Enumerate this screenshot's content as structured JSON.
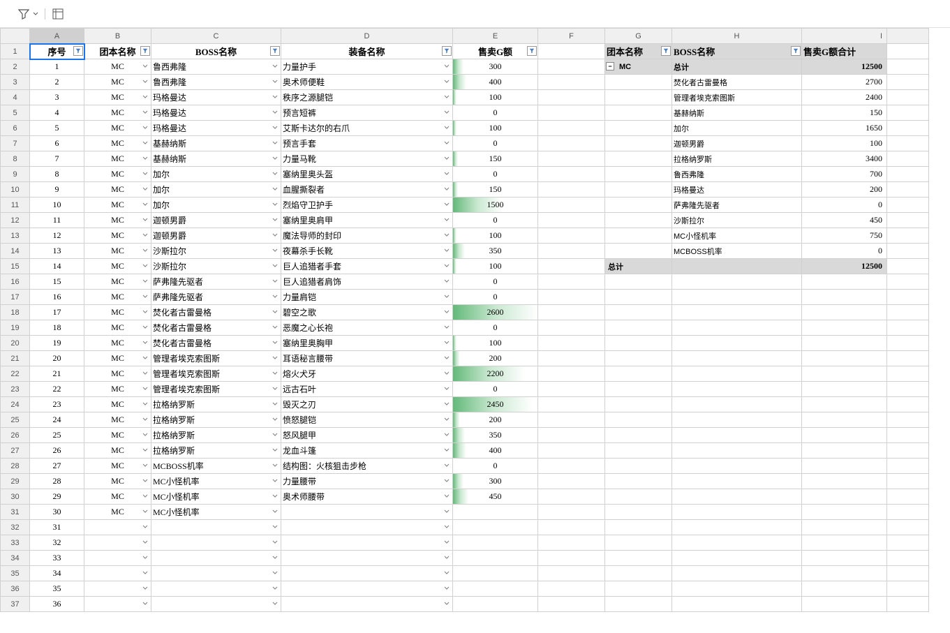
{
  "toolbar": {
    "filter_label": "筛选",
    "group_label": "分组"
  },
  "cols": [
    "A",
    "B",
    "C",
    "D",
    "E",
    "F",
    "G",
    "H",
    "I",
    ""
  ],
  "hdr": {
    "a": "序号",
    "b": "团本名称",
    "c": "BOSS名称",
    "d": "装备名称",
    "e": "售卖G额",
    "g": "团本名称",
    "h": "BOSS名称",
    "i": "售卖G额合计"
  },
  "rows": [
    {
      "n": "1",
      "a": "1",
      "b": "MC",
      "c": "鲁西弗隆",
      "d": "力量护手",
      "e": "300",
      "bar": 12
    },
    {
      "n": "2",
      "a": "2",
      "b": "MC",
      "c": "鲁西弗隆",
      "d": "奥术师便鞋",
      "e": "400",
      "bar": 16
    },
    {
      "n": "3",
      "a": "3",
      "b": "MC",
      "c": "玛格曼达",
      "d": "秩序之源腿铠",
      "e": "100",
      "bar": 4
    },
    {
      "n": "4",
      "a": "4",
      "b": "MC",
      "c": "玛格曼达",
      "d": "预言短裤",
      "e": "0",
      "bar": 0
    },
    {
      "n": "5",
      "a": "5",
      "b": "MC",
      "c": "玛格曼达",
      "d": "艾斯卡达尔的右爪",
      "e": "100",
      "bar": 4
    },
    {
      "n": "6",
      "a": "6",
      "b": "MC",
      "c": "基赫纳斯",
      "d": "预言手套",
      "e": "0",
      "bar": 0
    },
    {
      "n": "7",
      "a": "7",
      "b": "MC",
      "c": "基赫纳斯",
      "d": "力量马靴",
      "e": "150",
      "bar": 6
    },
    {
      "n": "8",
      "a": "8",
      "b": "MC",
      "c": "加尔",
      "d": "塞纳里奥头盔",
      "e": "0",
      "bar": 0
    },
    {
      "n": "9",
      "a": "9",
      "b": "MC",
      "c": "加尔",
      "d": "血腥撕裂者",
      "e": "150",
      "bar": 6
    },
    {
      "n": "10",
      "a": "10",
      "b": "MC",
      "c": "加尔",
      "d": "烈焰守卫护手",
      "e": "1500",
      "bar": 58
    },
    {
      "n": "11",
      "a": "11",
      "b": "MC",
      "c": "迦顿男爵",
      "d": "塞纳里奥肩甲",
      "e": "0",
      "bar": 0
    },
    {
      "n": "12",
      "a": "12",
      "b": "MC",
      "c": "迦顿男爵",
      "d": "魔法导师的封印",
      "e": "100",
      "bar": 4
    },
    {
      "n": "13",
      "a": "13",
      "b": "MC",
      "c": "沙斯拉尔",
      "d": "夜幕杀手长靴",
      "e": "350",
      "bar": 14
    },
    {
      "n": "14",
      "a": "14",
      "b": "MC",
      "c": "沙斯拉尔",
      "d": "巨人追猎者手套",
      "e": "100",
      "bar": 4
    },
    {
      "n": "15",
      "a": "15",
      "b": "MC",
      "c": "萨弗隆先驱者",
      "d": "巨人追猎者肩饰",
      "e": "0",
      "bar": 0
    },
    {
      "n": "16",
      "a": "16",
      "b": "MC",
      "c": "萨弗隆先驱者",
      "d": "力量肩铠",
      "e": "0",
      "bar": 0
    },
    {
      "n": "17",
      "a": "17",
      "b": "MC",
      "c": "焚化者古雷曼格",
      "d": "碧空之歌",
      "e": "2600",
      "bar": 100
    },
    {
      "n": "18",
      "a": "18",
      "b": "MC",
      "c": "焚化者古雷曼格",
      "d": "恶魔之心长袍",
      "e": "0",
      "bar": 0
    },
    {
      "n": "19",
      "a": "19",
      "b": "MC",
      "c": "焚化者古雷曼格",
      "d": "塞纳里奥胸甲",
      "e": "100",
      "bar": 4
    },
    {
      "n": "20",
      "a": "20",
      "b": "MC",
      "c": "管理者埃克索图斯",
      "d": "耳语秘言腰带",
      "e": "200",
      "bar": 8
    },
    {
      "n": "21",
      "a": "21",
      "b": "MC",
      "c": "管理者埃克索图斯",
      "d": "熔火犬牙",
      "e": "2200",
      "bar": 85
    },
    {
      "n": "22",
      "a": "22",
      "b": "MC",
      "c": "管理者埃克索图斯",
      "d": "远古石叶",
      "e": "0",
      "bar": 0
    },
    {
      "n": "23",
      "a": "23",
      "b": "MC",
      "c": "拉格纳罗斯",
      "d": "毁灭之刃",
      "e": "2450",
      "bar": 94
    },
    {
      "n": "24",
      "a": "24",
      "b": "MC",
      "c": "拉格纳罗斯",
      "d": "愤怒腿铠",
      "e": "200",
      "bar": 8
    },
    {
      "n": "25",
      "a": "25",
      "b": "MC",
      "c": "拉格纳罗斯",
      "d": "怒风腿甲",
      "e": "350",
      "bar": 14
    },
    {
      "n": "26",
      "a": "26",
      "b": "MC",
      "c": "拉格纳罗斯",
      "d": "龙血斗篷",
      "e": "400",
      "bar": 16
    },
    {
      "n": "27",
      "a": "27",
      "b": "MC",
      "c": "MCBOSS机率",
      "d": "结构图：火核狙击步枪",
      "e": "0",
      "bar": 0
    },
    {
      "n": "28",
      "a": "28",
      "b": "MC",
      "c": "MC小怪机率",
      "d": "力量腰带",
      "e": "300",
      "bar": 12
    },
    {
      "n": "29",
      "a": "29",
      "b": "MC",
      "c": "MC小怪机率",
      "d": "奥术师腰带",
      "e": "450",
      "bar": 18
    },
    {
      "n": "30",
      "a": "30",
      "b": "MC",
      "c": "MC小怪机率",
      "d": "",
      "e": ""
    },
    {
      "n": "31",
      "a": "31",
      "b": "",
      "c": "",
      "d": "",
      "e": ""
    },
    {
      "n": "32",
      "a": "32",
      "b": "",
      "c": "",
      "d": "",
      "e": ""
    },
    {
      "n": "33",
      "a": "33",
      "b": "",
      "c": "",
      "d": "",
      "e": ""
    },
    {
      "n": "34",
      "a": "34",
      "b": "",
      "c": "",
      "d": "",
      "e": ""
    },
    {
      "n": "35",
      "a": "35",
      "b": "",
      "c": "",
      "d": "",
      "e": ""
    },
    {
      "n": "36",
      "a": "36",
      "b": "",
      "c": "",
      "d": "",
      "e": ""
    }
  ],
  "pivot": [
    {
      "g": "MC",
      "h": "总计",
      "i": "12500",
      "collapse": true,
      "bold": true
    },
    {
      "g": "",
      "h": "焚化者古雷曼格",
      "i": "2700"
    },
    {
      "g": "",
      "h": "管理者埃克索图斯",
      "i": "2400"
    },
    {
      "g": "",
      "h": "基赫纳斯",
      "i": "150"
    },
    {
      "g": "",
      "h": "加尔",
      "i": "1650"
    },
    {
      "g": "",
      "h": "迦顿男爵",
      "i": "100"
    },
    {
      "g": "",
      "h": "拉格纳罗斯",
      "i": "3400"
    },
    {
      "g": "",
      "h": "鲁西弗隆",
      "i": "700"
    },
    {
      "g": "",
      "h": "玛格曼达",
      "i": "200"
    },
    {
      "g": "",
      "h": "萨弗隆先驱者",
      "i": "0"
    },
    {
      "g": "",
      "h": "沙斯拉尔",
      "i": "450"
    },
    {
      "g": "",
      "h": "MC小怪机率",
      "i": "750"
    },
    {
      "g": "",
      "h": "MCBOSS机率",
      "i": "0"
    }
  ],
  "grand_total": {
    "label": "总计",
    "value": "12500"
  }
}
